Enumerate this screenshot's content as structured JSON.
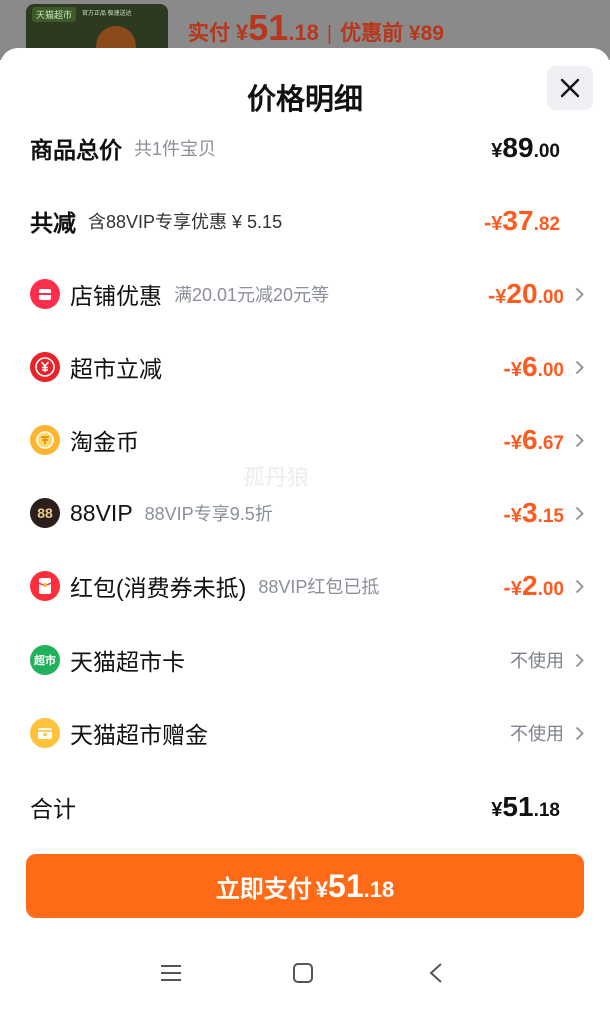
{
  "colors": {
    "accent": "#ff6a17",
    "discount": "#ff5a1f",
    "text": "#111111",
    "muted": "#8a8f99"
  },
  "header": {
    "product_tag": "天猫超市",
    "product_subtag": "官方正品 极速送达",
    "pay_label": "实付",
    "pay_currency": "¥",
    "pay_int": "51",
    "pay_dec": ".18",
    "separator": "|",
    "orig_label": "优惠前 ¥89"
  },
  "sheet": {
    "title": "价格明细"
  },
  "total_price": {
    "label": "商品总价",
    "sub": "共1件宝贝",
    "currency": "¥",
    "int": "89",
    "dec": ".00"
  },
  "total_discount": {
    "label": "共减",
    "sub": "含88VIP专享优惠 ¥ 5.15",
    "sign": "-",
    "currency": "¥",
    "int": "37",
    "dec": ".82"
  },
  "discounts": [
    {
      "label": "店铺优惠",
      "sub": "满20.01元减20元等",
      "icon": "shop-icon",
      "sign": "-",
      "currency": "¥",
      "int": "20",
      "dec": ".00"
    },
    {
      "label": "超市立减",
      "sub": "",
      "icon": "yuan-coupon-icon",
      "sign": "-",
      "currency": "¥",
      "int": "6",
      "dec": ".00"
    },
    {
      "label": "淘金币",
      "sub": "",
      "icon": "gold-coin-icon",
      "sign": "-",
      "currency": "¥",
      "int": "6",
      "dec": ".67"
    },
    {
      "label": "88VIP",
      "sub": "88VIP专享9.5折",
      "icon": "88vip-icon",
      "icon_text": "88",
      "sign": "-",
      "currency": "¥",
      "int": "3",
      "dec": ".15"
    },
    {
      "label": "红包(消费券未抵)",
      "sub": "88VIP红包已抵",
      "icon": "red-envelope-icon",
      "sign": "-",
      "currency": "¥",
      "int": "2",
      "dec": ".00"
    }
  ],
  "cards": [
    {
      "label": "天猫超市卡",
      "icon": "tmall-supermarket-card-icon",
      "icon_text": "超市",
      "status": "不使用"
    },
    {
      "label": "天猫超市赠金",
      "icon": "gift-money-icon",
      "status": "不使用"
    }
  ],
  "sum": {
    "label": "合计",
    "currency": "¥",
    "int": "51",
    "dec": ".18"
  },
  "pay_button": {
    "label": "立即支付",
    "currency": "¥",
    "int": "51",
    "dec": ".18"
  },
  "watermark": "孤丹狼"
}
